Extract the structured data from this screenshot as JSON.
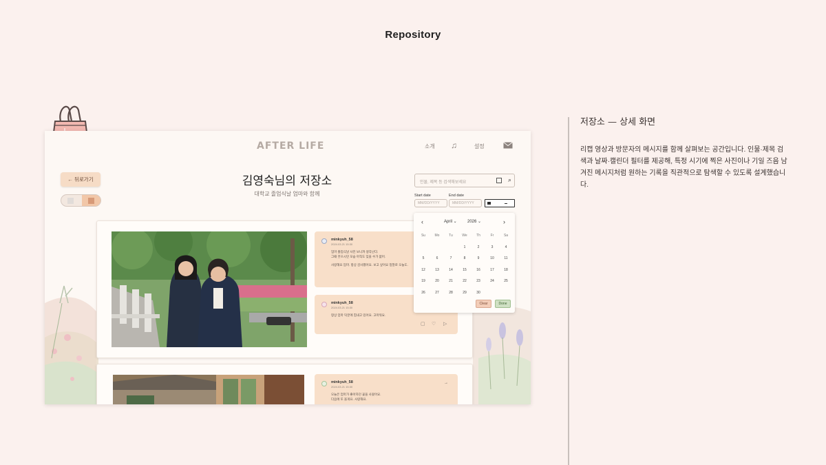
{
  "page": {
    "heading": "Repository"
  },
  "app": {
    "logo": "AFTER LIFE",
    "nav": {
      "intro": "소개",
      "settings": "설정"
    },
    "back_label": "← 뒤로가기",
    "repository_title": "김영숙님의 저장소",
    "repository_subtitle": "대학교 졸업식날 엄마와 함께",
    "search": {
      "placeholder": "인물, 제목 등 검색해보세요"
    },
    "date_filter": {
      "start_label": "Start date",
      "end_label": "End date",
      "start_placeholder": "MM/DD/YYYY",
      "end_placeholder": "MM/DD/YYYY"
    },
    "calendar": {
      "prev": "‹",
      "next": "›",
      "month": "April ⌄",
      "year": "2026 ⌄",
      "weekdays": [
        "Su",
        "Mo",
        "Tu",
        "We",
        "Th",
        "Fr",
        "Sa"
      ],
      "weeks": [
        [
          "",
          "",
          "",
          "1",
          "2",
          "3",
          "4"
        ],
        [
          "5",
          "6",
          "7",
          "8",
          "9",
          "10",
          "11"
        ],
        [
          "12",
          "13",
          "14",
          "15",
          "16",
          "17",
          "18"
        ],
        [
          "19",
          "20",
          "21",
          "22",
          "23",
          "24",
          "25"
        ],
        [
          "26",
          "27",
          "28",
          "29",
          "30",
          "",
          ""
        ]
      ],
      "clear_label": "Clear",
      "done_label": "Done"
    },
    "messages": [
      {
        "name": "minkyuh_58",
        "time": "2024.03.21 15:30",
        "line1": "엄마 졸업식날 사진 보니까 생각난다.",
        "line2": "그때 웃으시던 모습 아직도 잊을 수가 없어.",
        "line3": "사랑해요 엄마. 항상 감사했어요. 보고 싶어요 정말로 오늘도."
      },
      {
        "name": "minkyuh_58",
        "time": "2024.03.21 15:30",
        "line1": "항상 엄마 덕분에 힘내고 있어요. 고마워요."
      },
      {
        "name": "minkyuh_58",
        "time": "2024.03.21 15:30",
        "line1": "오늘은 엄마가 좋아하던 꽃을 사왔어요.",
        "line2": "다음에 또 올게요. 사랑해요."
      }
    ],
    "actions": {
      "bookmark": "▢",
      "like": "♡",
      "share": "▷",
      "arrow": "→"
    }
  },
  "panel": {
    "title": "저장소 — 상세 화면",
    "body": "리캡 영상과 방문자의 메시지를 함께 살펴보는 공간입니다. 인물·제목 검색과 날짜·캘린더 필터를 제공해, 특정 시기에 찍은 사진이나 기일 즈음 남겨진 메시지처럼 원하는 기록을 직관적으로 탐색할 수 있도록 설계했습니다."
  },
  "colors": {
    "background": "#fbf1ee",
    "accent_peach": "#f8dfc9",
    "done_green": "#cfe0c3",
    "clip_pink": "#f2b8b1"
  },
  "icons": [
    "binder-clip-icon",
    "music-note-icon",
    "mail-icon",
    "search-icon",
    "calendar-icon",
    "bookmark-icon",
    "heart-icon",
    "share-icon"
  ]
}
